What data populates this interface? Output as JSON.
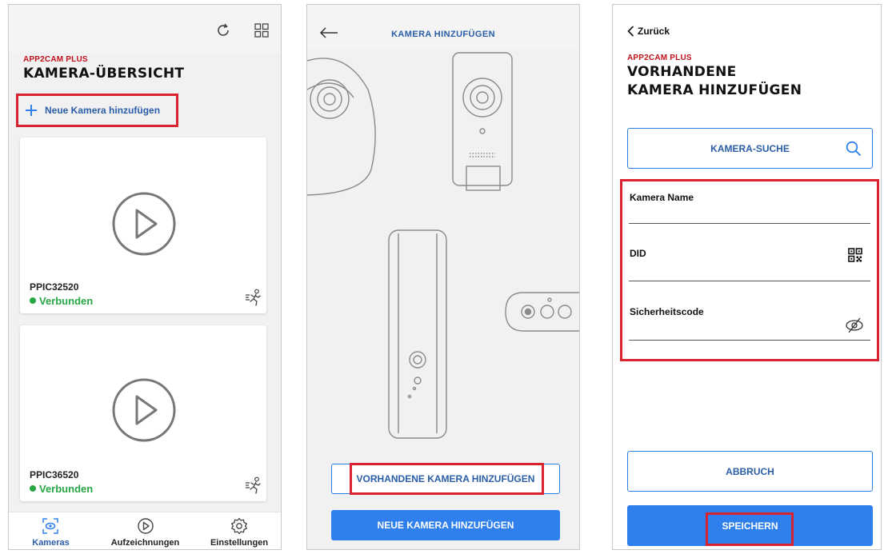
{
  "screen1": {
    "brand": "APP2CAM PLUS",
    "title": "KAMERA-ÜBERSICHT",
    "add_camera_label": "Neue Kamera hinzufügen",
    "cameras": [
      {
        "name": "PPIC32520",
        "status": "Verbunden"
      },
      {
        "name": "PPIC36520",
        "status": "Verbunden"
      }
    ],
    "nav": [
      {
        "label": "Kameras",
        "icon": "camera-icon",
        "active": true
      },
      {
        "label": "Aufzeichnungen",
        "icon": "play-circle-icon",
        "active": false
      },
      {
        "label": "Einstellungen",
        "icon": "settings-gear-icon",
        "active": false
      }
    ],
    "accent": "#2f80ed",
    "status_color": "#27a644"
  },
  "screen2": {
    "header_title": "KAMERA HINZUFÜGEN",
    "existing_button_label": "VORHANDENE KAMERA HINZUFÜGEN",
    "new_button_label": "NEUE KAMERA HINZUFÜGEN"
  },
  "screen3": {
    "back_label": "Zurück",
    "brand": "APP2CAM PLUS",
    "title_line1": "VORHANDENE",
    "title_line2": "KAMERA HINZUFÜGEN",
    "search_button_label": "KAMERA-SUCHE",
    "fields": [
      {
        "label": "Kamera Name",
        "value": ""
      },
      {
        "label": "DID",
        "value": ""
      },
      {
        "label": "Sicherheitscode",
        "value": ""
      }
    ],
    "cancel_label": "ABBRUCH",
    "save_label": "SPEICHERN"
  },
  "highlight_color": "#d9232e"
}
